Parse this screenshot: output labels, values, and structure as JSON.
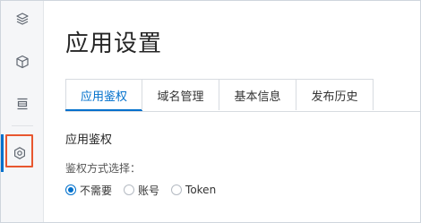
{
  "sidebar": {
    "items": [
      {
        "icon": "layers-icon"
      },
      {
        "icon": "cube-icon"
      },
      {
        "icon": "stack-icon"
      },
      {
        "icon": "settings-icon",
        "active": true,
        "highlighted": true
      }
    ]
  },
  "page": {
    "title": "应用设置"
  },
  "tabs": [
    {
      "label": "应用鉴权",
      "active": true
    },
    {
      "label": "域名管理",
      "active": false
    },
    {
      "label": "基本信息",
      "active": false
    },
    {
      "label": "发布历史",
      "active": false
    }
  ],
  "auth": {
    "section_title": "应用鉴权",
    "method_label": "鉴权方式选择：",
    "options": [
      {
        "label": "不需要",
        "checked": true
      },
      {
        "label": "账号",
        "checked": false
      },
      {
        "label": "Token",
        "checked": false
      }
    ]
  },
  "colors": {
    "accent": "#0070cc",
    "highlight": "#e8572f",
    "sidebar_bg": "#f5f6f8",
    "border": "#d7dbe0"
  }
}
